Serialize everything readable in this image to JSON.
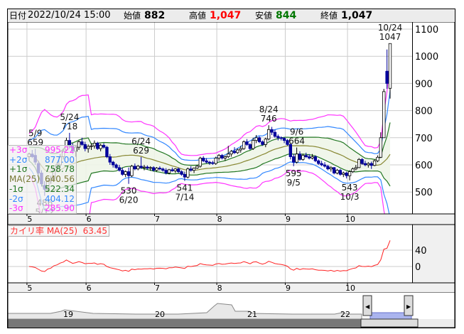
{
  "header": {
    "date_label": "日付",
    "date": "2022/10/24 15:00",
    "open_label": "始値",
    "open": "882",
    "high_label": "高値",
    "high": "1,047",
    "low_label": "安値",
    "low": "844",
    "close_label": "終値",
    "close": "1,047"
  },
  "colors": {
    "up": "#ffffff",
    "down": "#00009c",
    "plus3": "#ff33ff",
    "plus2": "#3388ff",
    "plus1": "#227722",
    "ma": "#888833",
    "kairi": "#ff2222",
    "high_val": "#ff0000",
    "low_val": "#007700"
  },
  "legend": [
    {
      "label": "+3σ",
      "value": "995.22",
      "color": "#ff33ff"
    },
    {
      "label": "+2σ",
      "value": "877.00",
      "color": "#3388ff"
    },
    {
      "label": "+1σ",
      "value": "758.78",
      "color": "#227722"
    },
    {
      "label": "MA(25)",
      "value": "640.56",
      "color": "#777733"
    },
    {
      "label": "-1σ",
      "value": "522.34",
      "color": "#227722"
    },
    {
      "label": "-2σ",
      "value": "404.12",
      "color": "#3388ff"
    },
    {
      "label": "-3σ",
      "value": "285.90",
      "color": "#ff33ff"
    }
  ],
  "indicator": {
    "label": "カイリ率 MA(25)",
    "value": "63.45",
    "y_ticks": [
      "40",
      "0"
    ]
  },
  "navigator": {
    "labels": [
      "19",
      "20",
      "21",
      "22"
    ]
  },
  "chart_data": {
    "type": "candlestick",
    "y_ticks": [
      1100,
      1000,
      900,
      800,
      700,
      600,
      500
    ],
    "ylim": [
      400,
      1130
    ],
    "months": [
      {
        "label": "5",
        "date": "5/2"
      },
      {
        "label": "6",
        "date": "6/1"
      },
      {
        "label": "7",
        "date": "7/1"
      },
      {
        "label": "8",
        "date": "8/1"
      },
      {
        "label": "9",
        "date": "9/1"
      },
      {
        "label": "10",
        "date": "10/3"
      }
    ],
    "annotations": [
      {
        "date": "5/9",
        "text1": "5/9",
        "text2": "659",
        "pos": "above",
        "price": 659
      },
      {
        "date": "5/12",
        "text1": "486",
        "text2": "5/12",
        "pos": "below",
        "price": 486
      },
      {
        "date": "5/24",
        "text1": "5/24",
        "text2": "718",
        "pos": "above",
        "price": 718
      },
      {
        "date": "6/20",
        "text1": "530",
        "text2": "6/20",
        "pos": "below",
        "price": 530
      },
      {
        "date": "6/24",
        "text1": "6/24",
        "text2": "629",
        "pos": "above",
        "price": 629
      },
      {
        "date": "7/14",
        "text1": "541",
        "text2": "7/14",
        "pos": "below",
        "price": 541
      },
      {
        "date": "8/24",
        "text1": "8/24",
        "text2": "746",
        "pos": "above",
        "price": 746
      },
      {
        "date": "9/5",
        "text1": "595",
        "text2": "9/5",
        "pos": "below",
        "price": 595
      },
      {
        "date": "9/6",
        "text1": "9/6",
        "text2": "664",
        "pos": "above",
        "price": 664
      },
      {
        "date": "10/3",
        "text1": "543",
        "text2": "10/3",
        "pos": "below",
        "price": 543
      },
      {
        "date": "10/24",
        "text1": "10/24",
        "text2": "1047",
        "pos": "above",
        "price": 1047
      }
    ],
    "candles": [
      [
        "5/2",
        630,
        645,
        615,
        640
      ],
      [
        "5/6",
        640,
        655,
        625,
        630
      ],
      [
        "5/9",
        635,
        659,
        600,
        610
      ],
      [
        "5/10",
        605,
        615,
        560,
        570
      ],
      [
        "5/11",
        570,
        580,
        520,
        530
      ],
      [
        "5/12",
        525,
        540,
        486,
        510
      ],
      [
        "5/13",
        510,
        545,
        500,
        540
      ],
      [
        "5/16",
        540,
        560,
        530,
        550
      ],
      [
        "5/17",
        550,
        590,
        545,
        585
      ],
      [
        "5/18",
        590,
        610,
        575,
        600
      ],
      [
        "5/19",
        600,
        640,
        595,
        630
      ],
      [
        "5/20",
        630,
        660,
        620,
        650
      ],
      [
        "5/23",
        655,
        700,
        650,
        690
      ],
      [
        "5/24",
        690,
        718,
        660,
        670
      ],
      [
        "5/25",
        670,
        680,
        640,
        650
      ],
      [
        "5/26",
        650,
        670,
        630,
        665
      ],
      [
        "5/27",
        665,
        690,
        655,
        685
      ],
      [
        "5/30",
        685,
        700,
        670,
        675
      ],
      [
        "5/31",
        675,
        685,
        650,
        660
      ],
      [
        "6/1",
        660,
        675,
        645,
        668
      ],
      [
        "6/2",
        668,
        680,
        655,
        670
      ],
      [
        "6/3",
        670,
        690,
        660,
        680
      ],
      [
        "6/6",
        680,
        685,
        655,
        660
      ],
      [
        "6/7",
        660,
        678,
        650,
        672
      ],
      [
        "6/8",
        672,
        680,
        660,
        665
      ],
      [
        "6/9",
        665,
        670,
        625,
        630
      ],
      [
        "6/10",
        630,
        640,
        600,
        610
      ],
      [
        "6/13",
        610,
        615,
        590,
        600
      ],
      [
        "6/14",
        600,
        605,
        585,
        590
      ],
      [
        "6/15",
        590,
        600,
        575,
        580
      ],
      [
        "6/16",
        580,
        590,
        560,
        565
      ],
      [
        "6/17",
        565,
        580,
        555,
        575
      ],
      [
        "6/20",
        575,
        590,
        530,
        560
      ],
      [
        "6/21",
        560,
        600,
        555,
        595
      ],
      [
        "6/22",
        595,
        605,
        580,
        585
      ],
      [
        "6/23",
        585,
        600,
        580,
        595
      ],
      [
        "6/24",
        595,
        629,
        585,
        590
      ],
      [
        "6/27",
        590,
        600,
        580,
        592
      ],
      [
        "6/28",
        592,
        598,
        582,
        588
      ],
      [
        "6/29",
        588,
        595,
        578,
        590
      ],
      [
        "6/30",
        590,
        595,
        575,
        580
      ],
      [
        "7/1",
        580,
        592,
        575,
        588
      ],
      [
        "7/4",
        588,
        595,
        580,
        585
      ],
      [
        "7/5",
        585,
        590,
        575,
        580
      ],
      [
        "7/6",
        580,
        588,
        565,
        570
      ],
      [
        "7/7",
        570,
        585,
        565,
        582
      ],
      [
        "7/8",
        582,
        590,
        575,
        578
      ],
      [
        "7/11",
        578,
        588,
        570,
        585
      ],
      [
        "7/12",
        585,
        590,
        570,
        575
      ],
      [
        "7/13",
        575,
        580,
        560,
        565
      ],
      [
        "7/14",
        565,
        575,
        541,
        555
      ],
      [
        "7/15",
        555,
        590,
        550,
        585
      ],
      [
        "7/19",
        585,
        595,
        575,
        580
      ],
      [
        "7/20",
        580,
        590,
        570,
        588
      ],
      [
        "7/21",
        588,
        600,
        585,
        595
      ],
      [
        "7/22",
        595,
        630,
        590,
        625
      ],
      [
        "7/25",
        625,
        632,
        610,
        615
      ],
      [
        "7/26",
        615,
        625,
        605,
        610
      ],
      [
        "7/27",
        610,
        615,
        600,
        608
      ],
      [
        "7/28",
        608,
        615,
        600,
        605
      ],
      [
        "7/29",
        605,
        630,
        600,
        625
      ],
      [
        "8/1",
        625,
        640,
        615,
        635
      ],
      [
        "8/2",
        635,
        640,
        620,
        625
      ],
      [
        "8/3",
        625,
        635,
        615,
        630
      ],
      [
        "8/4",
        630,
        670,
        625,
        640
      ],
      [
        "8/5",
        640,
        655,
        630,
        650
      ],
      [
        "8/8",
        650,
        665,
        640,
        645
      ],
      [
        "8/9",
        645,
        660,
        640,
        655
      ],
      [
        "8/10",
        655,
        670,
        645,
        660
      ],
      [
        "8/12",
        660,
        690,
        655,
        685
      ],
      [
        "8/15",
        685,
        695,
        670,
        675
      ],
      [
        "8/16",
        675,
        680,
        655,
        660
      ],
      [
        "8/17",
        660,
        700,
        655,
        690
      ],
      [
        "8/18",
        690,
        710,
        680,
        700
      ],
      [
        "8/19",
        700,
        705,
        680,
        685
      ],
      [
        "8/22",
        685,
        690,
        670,
        675
      ],
      [
        "8/23",
        675,
        700,
        665,
        695
      ],
      [
        "8/24",
        695,
        746,
        690,
        730
      ],
      [
        "8/25",
        730,
        740,
        710,
        720
      ],
      [
        "8/26",
        720,
        730,
        700,
        705
      ],
      [
        "8/29",
        705,
        712,
        690,
        700
      ],
      [
        "8/30",
        700,
        705,
        690,
        698
      ],
      [
        "8/31",
        698,
        702,
        680,
        690
      ],
      [
        "9/1",
        690,
        695,
        670,
        675
      ],
      [
        "9/2",
        675,
        680,
        620,
        630
      ],
      [
        "9/5",
        630,
        640,
        595,
        610
      ],
      [
        "9/6",
        610,
        664,
        605,
        640
      ],
      [
        "9/7",
        640,
        650,
        615,
        620
      ],
      [
        "9/8",
        620,
        640,
        615,
        635
      ],
      [
        "9/9",
        635,
        645,
        625,
        630
      ],
      [
        "9/12",
        630,
        640,
        620,
        625
      ],
      [
        "9/13",
        625,
        640,
        620,
        630
      ],
      [
        "9/14",
        630,
        635,
        610,
        615
      ],
      [
        "9/15",
        615,
        620,
        600,
        605
      ],
      [
        "9/16",
        605,
        615,
        595,
        600
      ],
      [
        "9/20",
        600,
        610,
        590,
        595
      ],
      [
        "9/21",
        595,
        600,
        580,
        585
      ],
      [
        "9/22",
        585,
        595,
        575,
        590
      ],
      [
        "9/26",
        590,
        592,
        565,
        570
      ],
      [
        "9/27",
        570,
        585,
        565,
        580
      ],
      [
        "9/28",
        580,
        585,
        560,
        565
      ],
      [
        "9/29",
        565,
        575,
        555,
        570
      ],
      [
        "9/30",
        570,
        575,
        550,
        560
      ],
      [
        "10/3",
        560,
        580,
        543,
        575
      ],
      [
        "10/4",
        575,
        590,
        570,
        585
      ],
      [
        "10/5",
        585,
        600,
        580,
        590
      ],
      [
        "10/6",
        590,
        625,
        588,
        620
      ],
      [
        "10/7",
        620,
        625,
        600,
        605
      ],
      [
        "10/11",
        605,
        615,
        595,
        600
      ],
      [
        "10/12",
        600,
        610,
        590,
        605
      ],
      [
        "10/13",
        605,
        612,
        585,
        598
      ],
      [
        "10/14",
        598,
        620,
        595,
        615
      ],
      [
        "10/17",
        615,
        635,
        610,
        628
      ],
      [
        "10/18",
        628,
        720,
        625,
        700
      ],
      [
        "10/19",
        700,
        880,
        700,
        870
      ],
      [
        "10/20",
        945,
        1025,
        880,
        900
      ],
      [
        "10/24",
        882,
        1047,
        844,
        1047
      ]
    ]
  }
}
